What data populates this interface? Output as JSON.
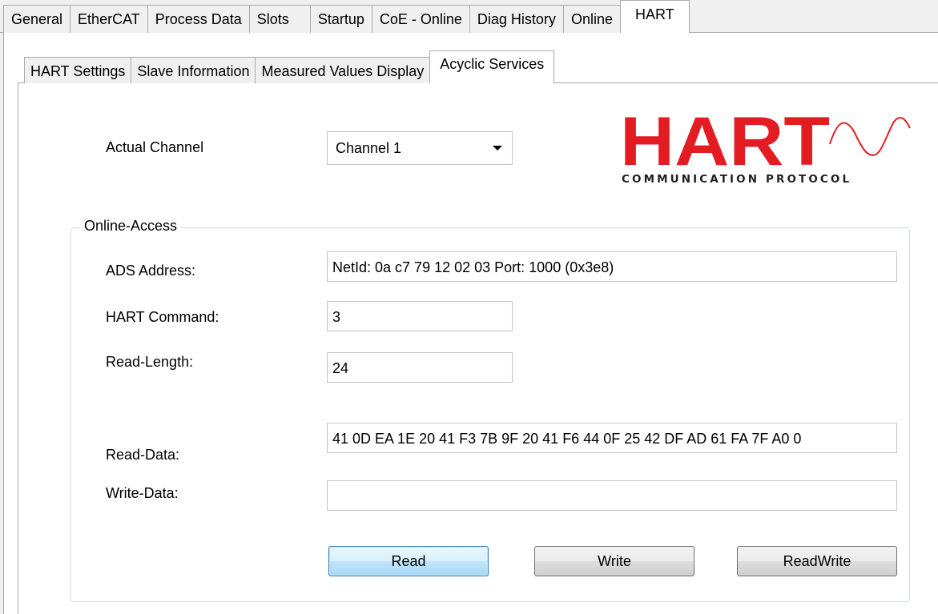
{
  "outer_tabs": [
    {
      "label": "General"
    },
    {
      "label": "EtherCAT"
    },
    {
      "label": "Process Data"
    },
    {
      "label": "Slots"
    },
    {
      "label": "Startup"
    },
    {
      "label": "CoE - Online"
    },
    {
      "label": "Diag History"
    },
    {
      "label": "Online"
    },
    {
      "label": "HART",
      "active": true
    }
  ],
  "inner_tabs": [
    {
      "label": "HART Settings"
    },
    {
      "label": "Slave Information"
    },
    {
      "label": "Measured Values Display"
    },
    {
      "label": "Acyclic Services",
      "active": true
    }
  ],
  "channel": {
    "label": "Actual Channel",
    "selected": "Channel 1"
  },
  "logo": {
    "wordmark": "HART",
    "tagline": "COMMUNICATION PROTOCOL",
    "color": "#e31b23",
    "icon": "sine-wave-icon"
  },
  "online_access": {
    "title": "Online-Access",
    "ads_address": {
      "label": "ADS Address:",
      "value": "NetId: 0a c7 79 12 02 03    Port: 1000 (0x3e8)"
    },
    "hart_command": {
      "label": "HART Command:",
      "value": "3"
    },
    "read_length": {
      "label": "Read-Length:",
      "value": "24"
    },
    "read_data": {
      "label": "Read-Data:",
      "value": "41 0D EA 1E 20 41 F3 7B 9F 20 41 F6 44 0F 25 42 DF AD 61 FA 7F A0 0"
    },
    "write_data": {
      "label": "Write-Data:",
      "value": ""
    },
    "buttons": {
      "read": "Read",
      "write": "Write",
      "readwrite": "ReadWrite"
    }
  }
}
